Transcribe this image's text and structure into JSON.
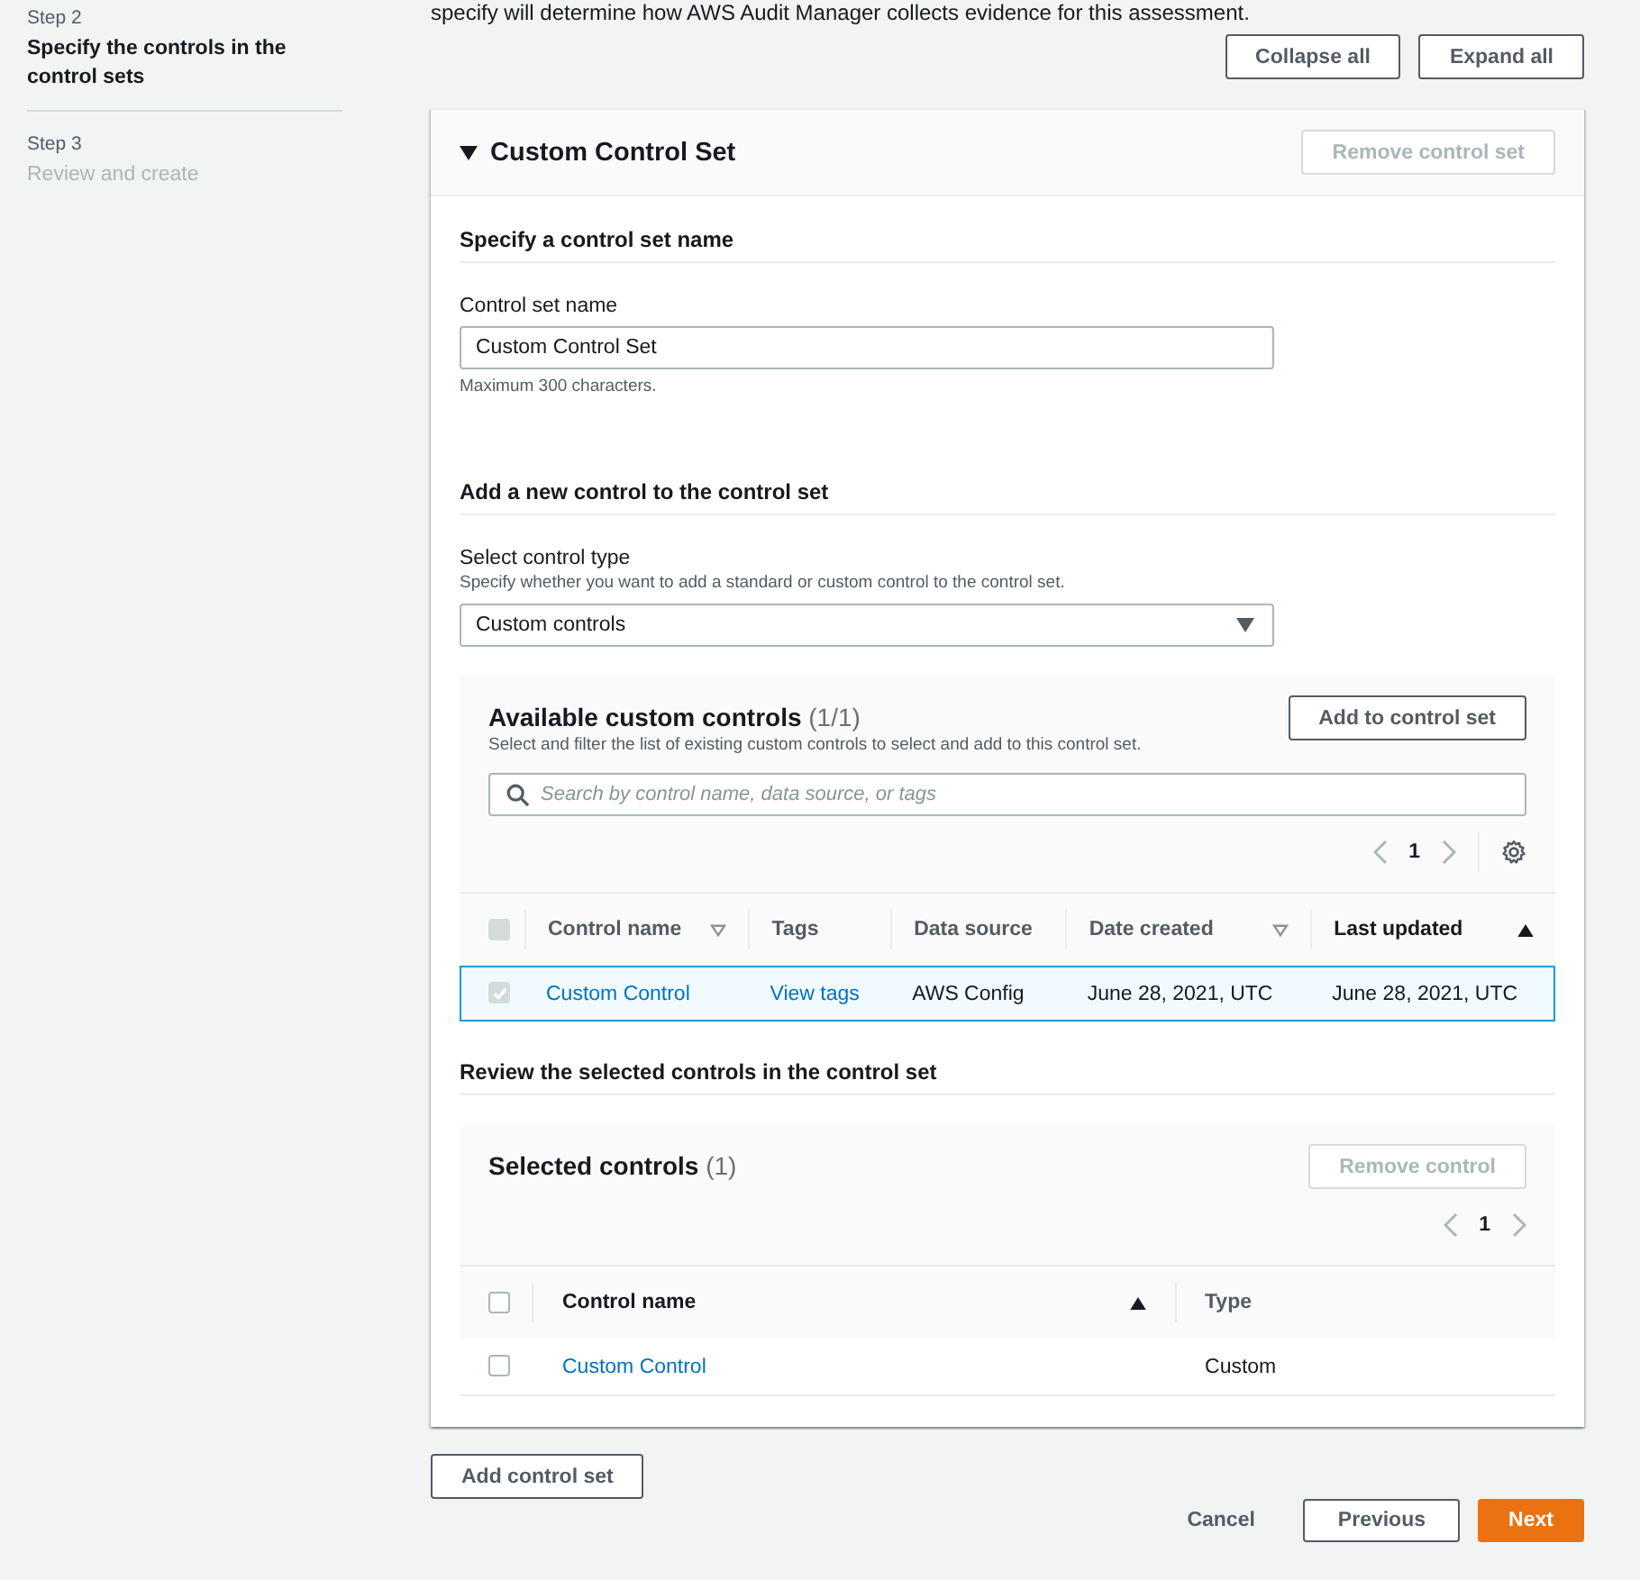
{
  "steps": [
    {
      "step": "Step 2",
      "title": "Specify the controls in the control sets",
      "selected": true
    },
    {
      "step": "Step 3",
      "title": "Review and create",
      "selected": false
    }
  ],
  "intro_text": "specify will determine how AWS Audit Manager collects evidence for this assessment.",
  "top_buttons": [
    "Collapse all",
    "Expand all"
  ],
  "control_set": {
    "title": "Custom Control Set",
    "expanded": true,
    "remove_button": {
      "label": "Remove control set",
      "disabled": true
    },
    "name_section": {
      "heading": "Specify a control set name",
      "field_label": "Control set name",
      "value": "Custom Control Set",
      "hint": "Maximum 300 characters."
    },
    "add_section": {
      "heading": "Add a new control to the control set",
      "type_label": "Select control type",
      "type_description": "Specify whether you want to add a standard or custom control to the control set.",
      "type_value": "Custom controls"
    },
    "available": {
      "title": "Available custom controls",
      "count": "(1/1)",
      "description": "Select and filter the list of existing custom controls to select and add to this control set.",
      "add_button": {
        "label": "Add to control set",
        "disabled": false
      },
      "search_placeholder": "Search by control name, data source, or tags",
      "page": "1",
      "header_checkbox": {
        "checked": false,
        "indeterminate": true
      },
      "columns": [
        {
          "label": "Control name",
          "sortable": true,
          "sorted": false
        },
        {
          "label": "Tags",
          "sortable": false,
          "sorted": false
        },
        {
          "label": "Data source",
          "sortable": false,
          "sorted": false
        },
        {
          "label": "Date created",
          "sortable": true,
          "sorted": false
        },
        {
          "label": "Last updated",
          "sortable": true,
          "sorted": true
        }
      ],
      "rows": [
        {
          "selected": true,
          "checked": true,
          "disabled": true,
          "cells": [
            {
              "text": "Custom Control",
              "kind": "link"
            },
            {
              "text": "View tags",
              "kind": "link"
            },
            {
              "text": "AWS Config",
              "kind": "text"
            },
            {
              "text": "June 28, 2021, UTC",
              "kind": "text"
            },
            {
              "text": "June 28, 2021, UTC",
              "kind": "text"
            }
          ]
        }
      ]
    },
    "review_heading": "Review the selected controls in the control set",
    "selected_controls": {
      "title": "Selected controls",
      "count": "(1)",
      "remove_button": {
        "label": "Remove control",
        "disabled": true
      },
      "page": "1",
      "header_checkbox": {
        "checked": false,
        "indeterminate": false
      },
      "columns": [
        {
          "label": "Control name",
          "sortable": true,
          "sorted": true
        },
        {
          "label": "Type",
          "sortable": false,
          "sorted": false
        }
      ],
      "rows": [
        {
          "selected": false,
          "checked": false,
          "disabled": false,
          "cells": [
            {
              "text": "Custom Control",
              "kind": "link"
            },
            {
              "text": "Custom",
              "kind": "text"
            }
          ]
        }
      ]
    }
  },
  "add_control_set": "Add control set",
  "footer": {
    "cancel": "Cancel",
    "previous": "Previous",
    "next": "Next"
  }
}
